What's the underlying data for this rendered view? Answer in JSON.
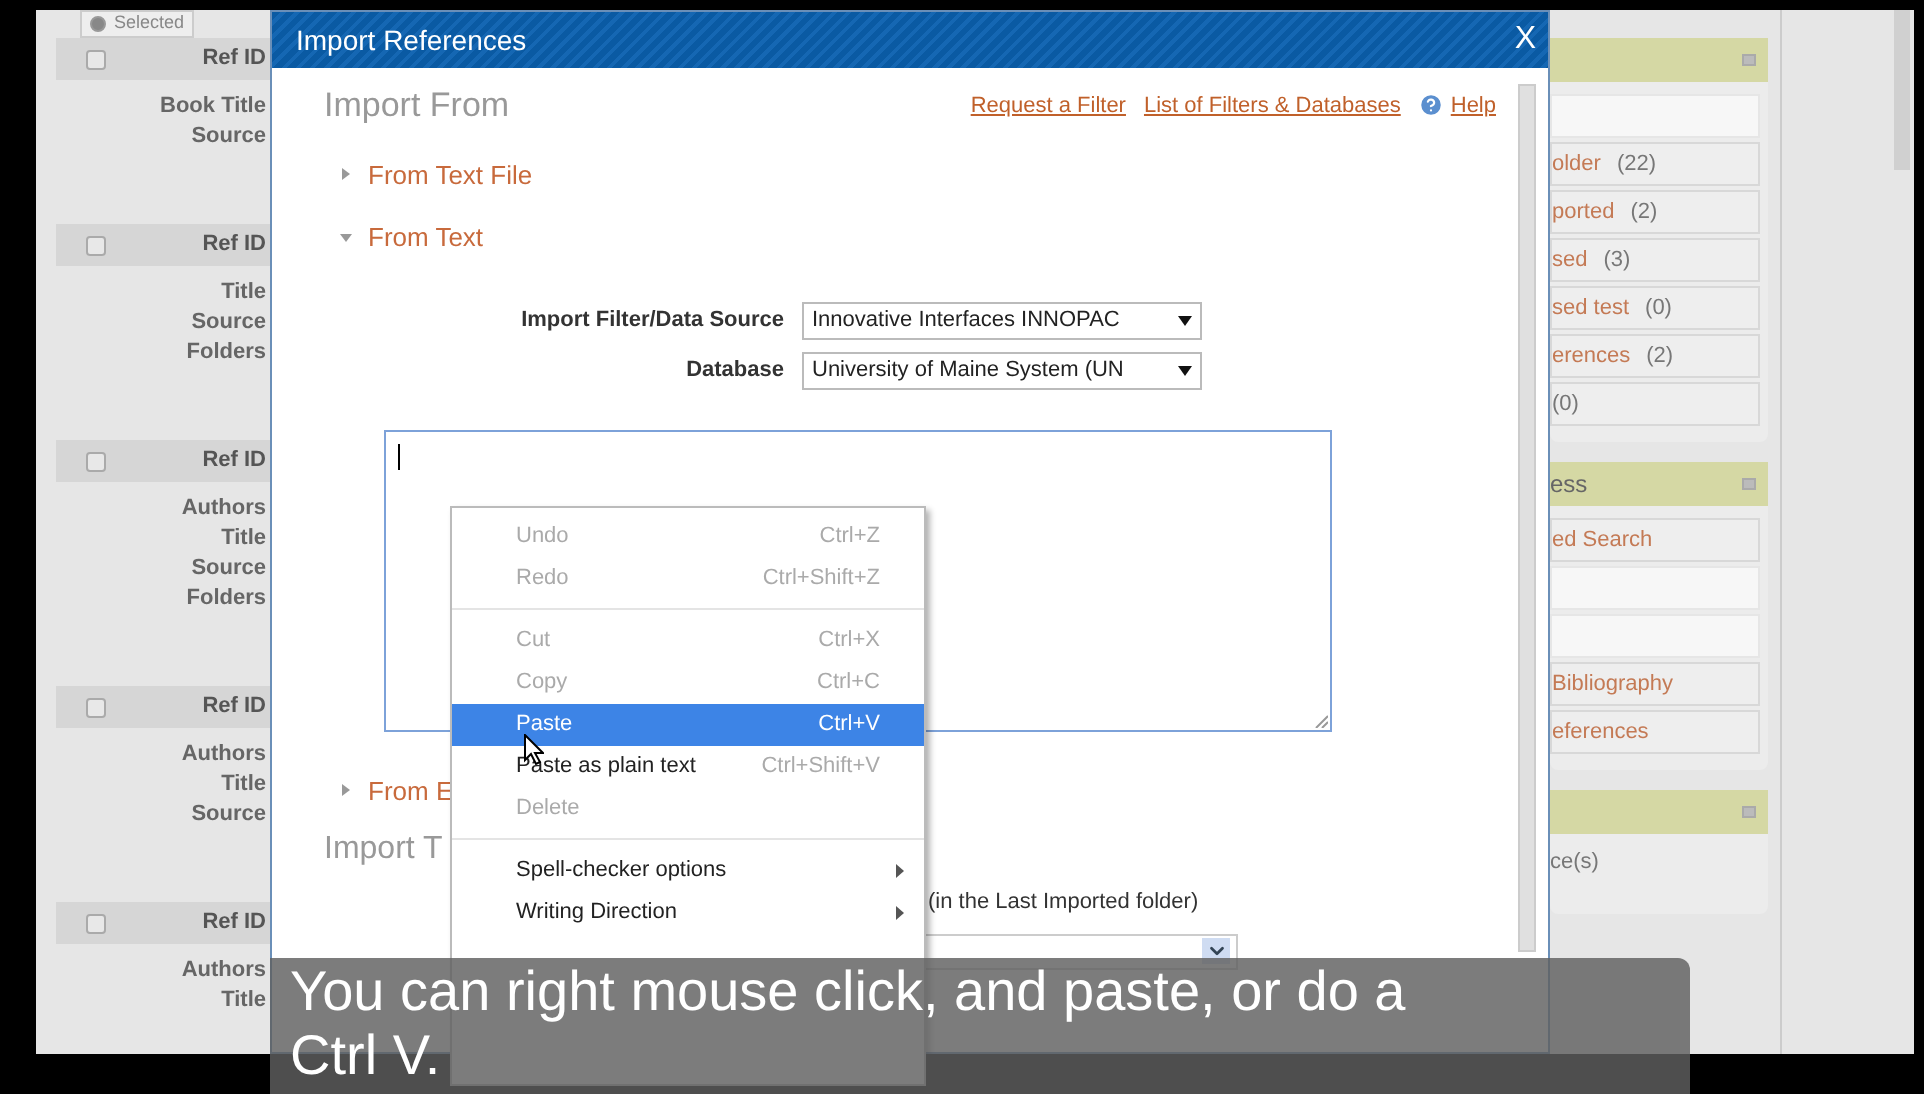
{
  "left_list": {
    "selected_option": {
      "label": "Selected",
      "selected": true
    },
    "rows": [
      {
        "header": "Ref ID",
        "checked": false,
        "labels": [
          "Book Title",
          "Source"
        ]
      },
      {
        "header": "Ref ID",
        "checked": false,
        "labels": [
          "Title",
          "Source",
          "Folders"
        ]
      },
      {
        "header": "Ref ID",
        "checked": false,
        "labels": [
          "Authors",
          "Title",
          "Source",
          "Folders"
        ]
      },
      {
        "header": "Ref ID",
        "checked": false,
        "labels": [
          "Authors",
          "Title",
          "Source"
        ]
      },
      {
        "header": "Ref ID",
        "checked": false,
        "labels": [
          "Authors",
          "Title"
        ]
      }
    ]
  },
  "dialog": {
    "title": "Import References",
    "close": "X",
    "heading": "Import From",
    "links": [
      "Request a Filter",
      "List of Filters & Databases"
    ],
    "help": "Help",
    "sections": [
      {
        "label": "From Text File",
        "expanded": false
      },
      {
        "label": "From Text",
        "expanded": true
      }
    ],
    "fields": [
      {
        "label": "Import Filter/Data Source",
        "value": "Innovative Interfaces INNOPAC"
      },
      {
        "label": "Database",
        "value": "University of Maine System (UN"
      }
    ],
    "section_below": {
      "label": "From E",
      "expanded": false
    },
    "heading_2": "Import T",
    "folder_note": "(in the Last Imported folder)"
  },
  "context_menu": {
    "groups": [
      [
        {
          "label": "Undo",
          "shortcut": "Ctrl+Z",
          "disabled": true,
          "selected": false
        },
        {
          "label": "Redo",
          "shortcut": "Ctrl+Shift+Z",
          "disabled": true,
          "selected": false
        }
      ],
      [
        {
          "label": "Cut",
          "shortcut": "Ctrl+X",
          "disabled": true,
          "selected": false
        },
        {
          "label": "Copy",
          "shortcut": "Ctrl+C",
          "disabled": true,
          "selected": false
        },
        {
          "label": "Paste",
          "shortcut": "Ctrl+V",
          "disabled": false,
          "selected": true
        },
        {
          "label": "Paste as plain text",
          "shortcut": "Ctrl+Shift+V",
          "disabled": false,
          "selected": false
        },
        {
          "label": "Delete",
          "disabled": true,
          "selected": false
        }
      ],
      [
        {
          "label": "Spell-checker options",
          "submenu": true,
          "disabled": false,
          "selected": false
        },
        {
          "label": "Writing Direction",
          "submenu": true,
          "disabled": false,
          "selected": false
        }
      ]
    ]
  },
  "sidebar": {
    "panels": [
      {
        "items": [
          {
            "kind": "blank"
          },
          {
            "kind": "link",
            "label": "older",
            "count": "(22)"
          },
          {
            "kind": "link",
            "label": "ported",
            "count": "(2)"
          },
          {
            "kind": "link",
            "label": "sed",
            "count": "(3)"
          },
          {
            "kind": "link",
            "label": "sed test",
            "count": "(0)"
          },
          {
            "kind": "link",
            "label": "erences",
            "count": "(2)"
          },
          {
            "kind": "link",
            "count": "(0)"
          }
        ]
      },
      {
        "header": "ess",
        "items": [
          {
            "kind": "link",
            "label": "ed Search"
          },
          {
            "kind": "blank"
          },
          {
            "kind": "blank"
          },
          {
            "kind": "link",
            "label": "Bibliography"
          },
          {
            "kind": "link",
            "label": "eferences"
          }
        ]
      },
      {
        "lines": [
          "ce(s)"
        ]
      }
    ]
  },
  "caption": {
    "lines": [
      "You can right mouse click, and paste, or do a",
      "Ctrl V."
    ]
  }
}
